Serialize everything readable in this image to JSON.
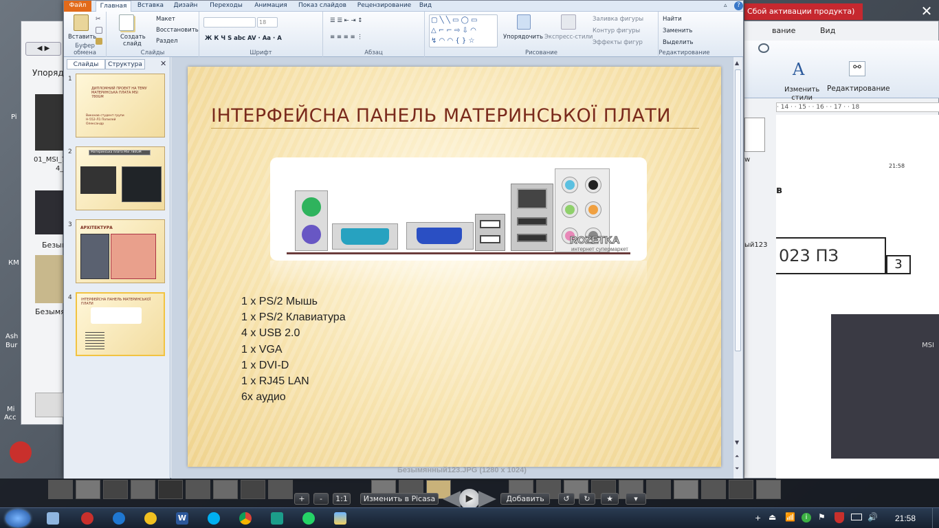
{
  "ribbon_tabs": [
    "Файл",
    "Главная",
    "Вставка",
    "Дизайн",
    "Переходы",
    "Анимация",
    "Показ слайдов",
    "Рецензирование",
    "Вид"
  ],
  "clipboard": {
    "paste": "Вставить",
    "group": "Буфер обмена"
  },
  "slides_group": {
    "new": "Создать",
    "new2": "слайд",
    "layout": "Макет",
    "reset": "Восстановить",
    "section": "Раздел",
    "group": "Слайды"
  },
  "font_group": {
    "size": "18",
    "group": "Шрифт"
  },
  "para_group": {
    "group": "Абзац"
  },
  "draw_group": {
    "arrange": "Упорядочить",
    "styles": "Экспресс-стили",
    "fill": "Заливка фигуры",
    "outline": "Контур фигуры",
    "effects": "Эффекты фигур",
    "group": "Рисование"
  },
  "edit_group": {
    "find": "Найти",
    "replace": "Заменить",
    "select": "Выделить",
    "group": "Редактирование"
  },
  "pane_tabs": [
    "Слайды",
    "Структура"
  ],
  "thumbs": [
    {
      "num": "1",
      "title": "ДИПЛОМНИЙ ПРОЕКТ НА ТЕМУ МАТЕРИНСЬКА ПЛАТА MSI 780GM",
      "sub": "Виконав студент групи Н-552-Л1 Попилей Олександр"
    },
    {
      "num": "2",
      "title": "Материнська плата MSI 780GM"
    },
    {
      "num": "3",
      "title": "АРХІТЕКТУРА"
    },
    {
      "num": "4",
      "title": "ІНТЕРФЕЙСНА ПАНЕЛЬ МАТЕРИНСЬКОЇ ПЛАТИ"
    }
  ],
  "slide": {
    "title": "Інтерфейсна панель материнської плати",
    "watermark": "ROZETKA",
    "watermark_sub": "интернет супермаркет",
    "bullets": [
      "1 x PS/2 Мышь",
      "1 x PS/2 Клавиатура",
      "4 x USB 2.0",
      "1 x VGA",
      "1 x DVI-D",
      "1 x RJ45 LAN",
      "6x аудио"
    ]
  },
  "bg": {
    "activation": "Сбой активации продукта)",
    "menu_view": "вание",
    "menu_view2": "Вид",
    "change_styles": "Изменить",
    "change_styles2": "стили",
    "editing": "Редактирование",
    "ruler": "· 14 · · 15 · · 16 · · 17 · · 18",
    "doc_code": "023 ПЗ",
    "doc_num": "3",
    "doc_letter": "в",
    "doc_w": "w",
    "img_label": "ый123",
    "left_items": [
      "Упорядо",
      "01_MSI_7",
      "4_",
      "Безымя",
      "Безымян",
      "Ash",
      "Bur",
      "Mi",
      "Acc",
      "КМ",
      "Pi"
    ],
    "clock_small": "21:58"
  },
  "viewer": {
    "filename": "Безымянный123.JPG (1280 x 1024)",
    "zoom_plus": "+",
    "zoom_minus": "-",
    "one": "1:1",
    "picasa": "Изменить в Picasa",
    "add": "Добавить"
  },
  "taskbar": {
    "time": "21:58"
  },
  "colors": {
    "title": "#7a2a1c",
    "ribbon_file": "#e26a1a"
  }
}
